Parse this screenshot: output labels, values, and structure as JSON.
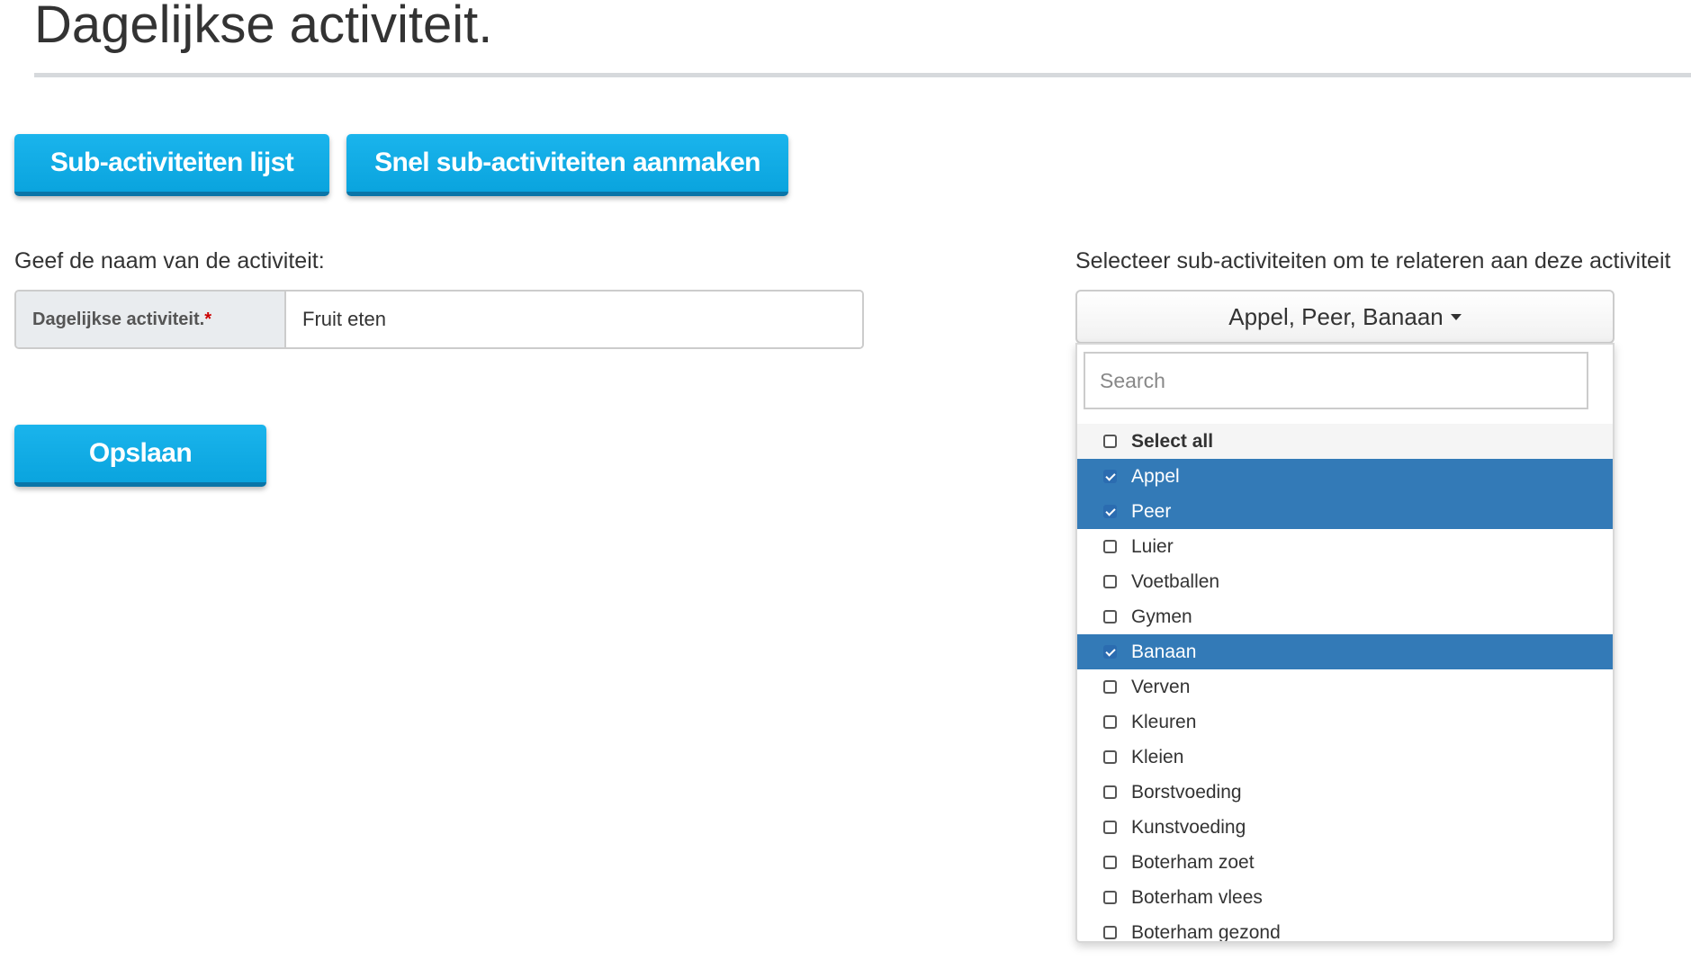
{
  "page": {
    "title": "Dagelijkse activiteit."
  },
  "buttons": {
    "sub_list": "Sub-activiteiten lijst",
    "quick_create": "Snel sub-activiteiten aanmaken",
    "save": "Opslaan"
  },
  "form": {
    "name_label": "Geef de naam van de activiteit:",
    "addon_label": "Dagelijkse activiteit.",
    "required_mark": "*",
    "name_value": "Fruit eten"
  },
  "multiselect": {
    "label": "Selecteer sub-activiteiten om te relateren aan deze activiteit",
    "selected_text": "Appel, Peer, Banaan",
    "search_placeholder": "Search",
    "select_all": "Select all",
    "options": [
      {
        "label": "Appel",
        "checked": true
      },
      {
        "label": "Peer",
        "checked": true
      },
      {
        "label": "Luier",
        "checked": false
      },
      {
        "label": "Voetballen",
        "checked": false
      },
      {
        "label": "Gymen",
        "checked": false
      },
      {
        "label": "Banaan",
        "checked": true
      },
      {
        "label": "Verven",
        "checked": false
      },
      {
        "label": "Kleuren",
        "checked": false
      },
      {
        "label": "Kleien",
        "checked": false
      },
      {
        "label": "Borstvoeding",
        "checked": false
      },
      {
        "label": "Kunstvoeding",
        "checked": false
      },
      {
        "label": "Boterham zoet",
        "checked": false
      },
      {
        "label": "Boterham vlees",
        "checked": false
      },
      {
        "label": "Boterham gezond",
        "checked": false
      }
    ]
  },
  "colors": {
    "primary_button": "#0aa4de",
    "selected_option": "#337ab7",
    "required": "#cc0000"
  }
}
